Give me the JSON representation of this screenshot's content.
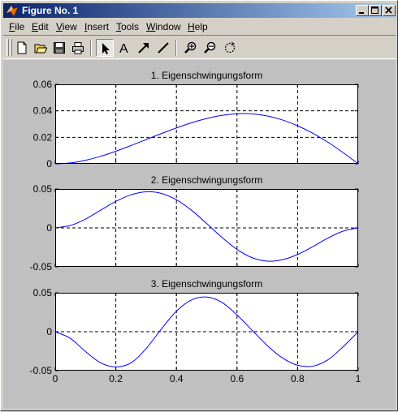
{
  "window": {
    "title": "Figure No. 1"
  },
  "icons": {
    "app": "matlab-icon",
    "minimize": "minimize-icon",
    "maximize": "maximize-icon",
    "close": "close-icon"
  },
  "menubar": {
    "items": [
      {
        "ul": "F",
        "rest": "ile"
      },
      {
        "ul": "E",
        "rest": "dit"
      },
      {
        "ul": "V",
        "rest": "iew"
      },
      {
        "ul": "I",
        "rest": "nsert"
      },
      {
        "ul": "T",
        "rest": "ools"
      },
      {
        "ul": "W",
        "rest": "indow"
      },
      {
        "ul": "H",
        "rest": "elp"
      }
    ]
  },
  "toolbar": {
    "buttons": [
      "new-figure-icon",
      "open-file-icon",
      "save-icon",
      "print-icon",
      "edit-plot-arrow-icon",
      "insert-text-icon",
      "insert-arrow-icon",
      "insert-line-icon",
      "zoom-in-icon",
      "zoom-out-icon",
      "rotate-3d-icon"
    ],
    "text_tool_label": "A"
  },
  "colors": {
    "titlebar_start": "#0a246a",
    "titlebar_end": "#a6caf0",
    "line": "#0000ff",
    "figure_bg": "#c0c0c0",
    "axes_bg": "#ffffff"
  },
  "chart_data": [
    {
      "type": "line",
      "title": "1. Eigenschwingungsform",
      "xlim": [
        0,
        1
      ],
      "ylim": [
        0,
        0.06
      ],
      "yticks": [
        0,
        0.02,
        0.04,
        0.06
      ],
      "ytick_labels": [
        "0",
        "0.02",
        "0.04",
        "0.06"
      ],
      "xticks": [
        0,
        0.2,
        0.4,
        0.6,
        0.8,
        1
      ],
      "xtick_labels": [],
      "grid": true,
      "x": [
        0,
        0.05,
        0.1,
        0.15,
        0.2,
        0.25,
        0.3,
        0.35,
        0.4,
        0.45,
        0.5,
        0.55,
        0.6,
        0.65,
        0.7,
        0.75,
        0.8,
        0.85,
        0.9,
        0.95,
        1
      ],
      "y": [
        0,
        0.0007,
        0.0027,
        0.0057,
        0.0095,
        0.0138,
        0.0183,
        0.0228,
        0.0271,
        0.031,
        0.0342,
        0.0366,
        0.0378,
        0.0377,
        0.0361,
        0.0331,
        0.0287,
        0.0231,
        0.0163,
        0.0085,
        0
      ]
    },
    {
      "type": "line",
      "title": "2. Eigenschwingungsform",
      "xlim": [
        0,
        1
      ],
      "ylim": [
        -0.05,
        0.05
      ],
      "yticks": [
        -0.05,
        0,
        0.05
      ],
      "ytick_labels": [
        "-0.05",
        "0",
        "0.05"
      ],
      "xticks": [
        0,
        0.2,
        0.4,
        0.6,
        0.8,
        1
      ],
      "xtick_labels": [],
      "grid": true,
      "x": [
        0,
        0.05,
        0.1,
        0.15,
        0.2,
        0.25,
        0.3,
        0.35,
        0.4,
        0.45,
        0.5,
        0.55,
        0.6,
        0.65,
        0.7,
        0.75,
        0.8,
        0.85,
        0.9,
        0.95,
        1
      ],
      "y": [
        0,
        0.0031,
        0.0113,
        0.0228,
        0.034,
        0.0425,
        0.0464,
        0.0443,
        0.0361,
        0.0226,
        0.0056,
        -0.0121,
        -0.0277,
        -0.0383,
        -0.0427,
        -0.0409,
        -0.0341,
        -0.0241,
        -0.0131,
        -0.0042,
        0
      ]
    },
    {
      "type": "line",
      "title": "3. Eigenschwingungsform",
      "xlim": [
        0,
        1
      ],
      "ylim": [
        -0.05,
        0.05
      ],
      "yticks": [
        -0.05,
        0,
        0.05
      ],
      "ytick_labels": [
        "-0.05",
        "0",
        "0.05"
      ],
      "xticks": [
        0,
        0.2,
        0.4,
        0.6,
        0.8,
        1
      ],
      "xtick_labels": [
        "0",
        "0.2",
        "0.4",
        "0.6",
        "0.8",
        "1"
      ],
      "grid": true,
      "x": [
        0,
        0.05,
        0.1,
        0.15,
        0.2,
        0.25,
        0.3,
        0.35,
        0.4,
        0.45,
        0.5,
        0.55,
        0.6,
        0.65,
        0.7,
        0.75,
        0.8,
        0.85,
        0.9,
        0.95,
        1
      ],
      "y": [
        0,
        -0.0085,
        -0.0255,
        -0.04,
        -0.0452,
        -0.04,
        -0.0217,
        0.0033,
        0.0263,
        0.0408,
        0.0445,
        0.0377,
        0.0215,
        0.0018,
        -0.0178,
        -0.0337,
        -0.0431,
        -0.0442,
        -0.0361,
        -0.0194,
        0
      ]
    }
  ]
}
